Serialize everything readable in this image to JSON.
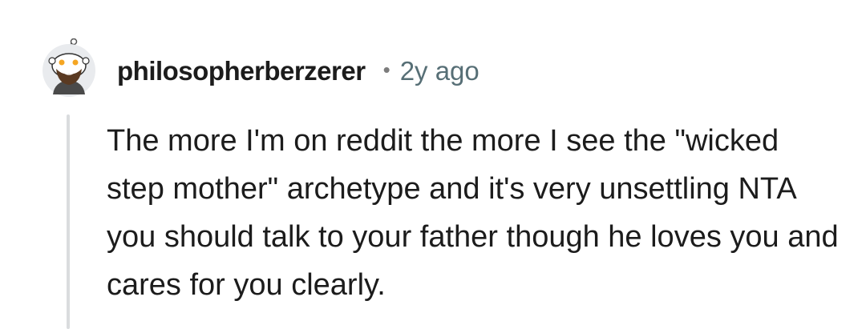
{
  "comment": {
    "author": "philosopherberzerer",
    "separator": "•",
    "timestamp": "2y ago",
    "avatar_icon": "snoo-avatar-icon",
    "body": "The more I'm on reddit the more I see the \"wicked step mother\" archetype and it's very unsettling NTA you should talk to your father though he loves you and cares for you clearly."
  },
  "colors": {
    "text": "#1c1c1c",
    "meta": "#576f76",
    "thread_line": "#dadcde",
    "background": "#ffffff"
  }
}
